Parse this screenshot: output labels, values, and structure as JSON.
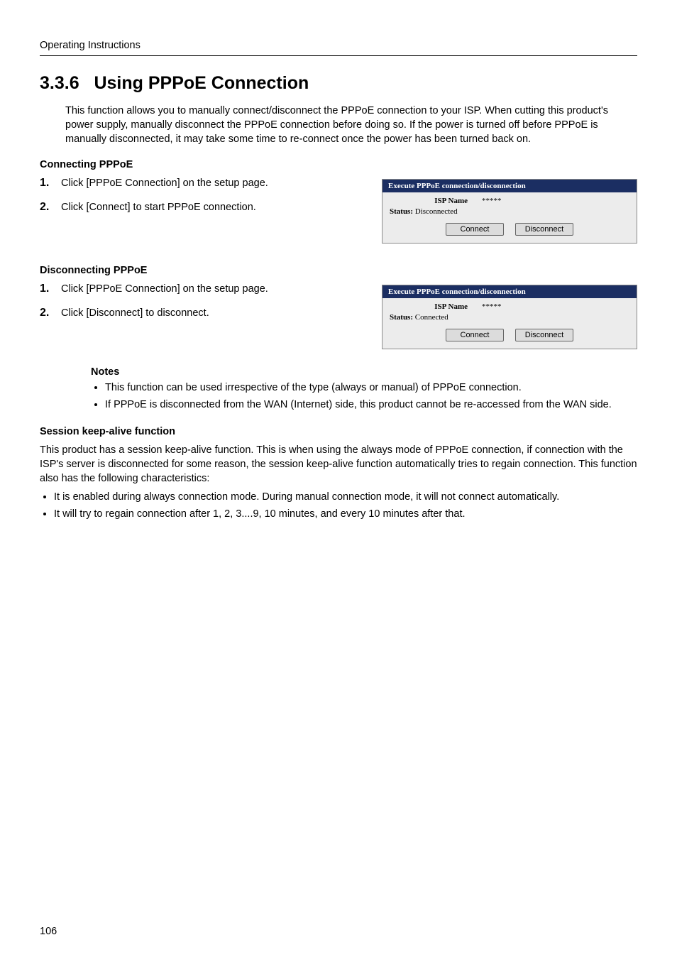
{
  "header": "Operating Instructions",
  "section_number": "3.3.6",
  "section_title": "Using PPPoE Connection",
  "intro": "This function allows you to manually connect/disconnect the PPPoE connection to your ISP. When cutting this product's power supply, manually disconnect the PPPoE connection before doing so. If the power is turned off before PPPoE is manually disconnected, it may take some time to re-connect once the power has been turned back on.",
  "connect": {
    "heading": "Connecting PPPoE",
    "steps": [
      {
        "num": "1.",
        "text": "Click [PPPoE Connection] on the setup page."
      },
      {
        "num": "2.",
        "text": "Click [Connect] to start PPPoE connection."
      }
    ],
    "panel": {
      "title": "Execute PPPoE connection/disconnection",
      "isp_label": "ISP Name",
      "isp_value": "*****",
      "status_label": "Status:",
      "status_value": "Disconnected",
      "btn_connect": "Connect",
      "btn_disconnect": "Disconnect"
    }
  },
  "disconnect": {
    "heading": "Disconnecting PPPoE",
    "steps": [
      {
        "num": "1.",
        "text": "Click [PPPoE Connection] on the setup page."
      },
      {
        "num": "2.",
        "text": "Click [Disconnect] to disconnect."
      }
    ],
    "panel": {
      "title": "Execute PPPoE connection/disconnection",
      "isp_label": "ISP Name",
      "isp_value": "*****",
      "status_label": "Status:",
      "status_value": "Connected",
      "btn_connect": "Connect",
      "btn_disconnect": "Disconnect"
    }
  },
  "notes": {
    "heading": "Notes",
    "items": [
      "This function can be used irrespective of the type (always or manual) of PPPoE connection.",
      "If PPPoE is disconnected from the WAN (Internet) side, this product cannot be re-accessed from the WAN side."
    ]
  },
  "session": {
    "heading": "Session keep-alive function",
    "text": "This product has a session keep-alive function. This is when using the always mode of PPPoE connection, if connection with the ISP's server is disconnected for some reason, the session keep-alive function automatically tries to regain connection. This function also has the following characteristics:",
    "items": [
      "It is enabled during always connection mode. During manual connection mode, it will not connect automatically.",
      "It will try to regain connection after 1, 2, 3....9, 10 minutes, and every 10 minutes after that."
    ]
  },
  "page_number": "106"
}
